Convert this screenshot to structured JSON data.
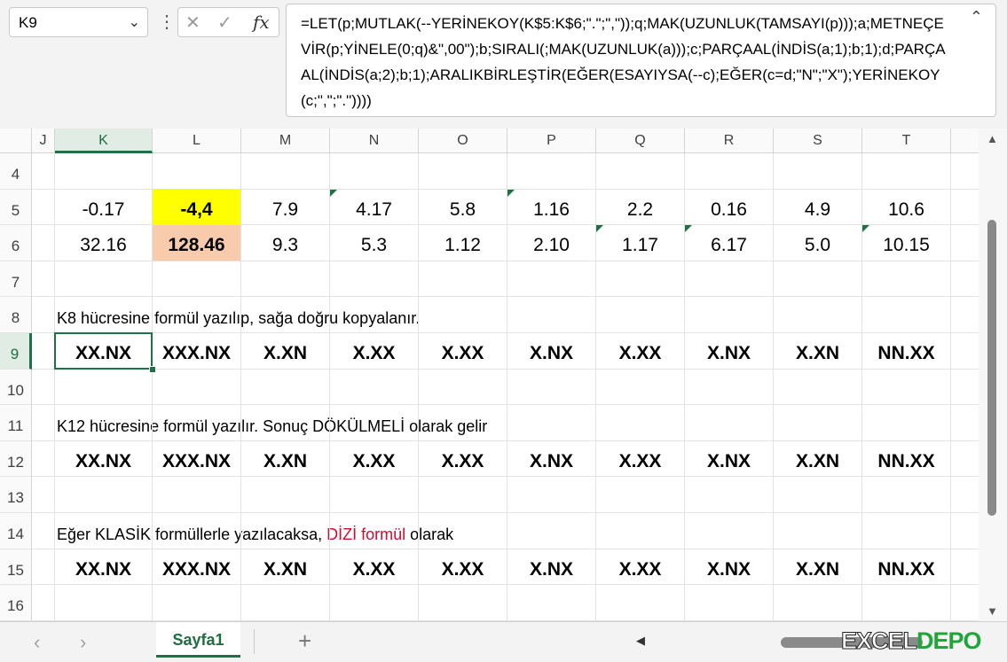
{
  "formula_bar": {
    "name_box": "K9",
    "cancel_icon": "✕",
    "enter_icon": "✓",
    "fx_label": "fx",
    "formula": "=LET(p;MUTLAK(--YERİNEKOY(K$5:K$6;\".\";\",\"));q;MAK(UZUNLUK(TAMSAYI(p)));a;METNEÇEVİR(p;YİNELE(0;q)&\",00\");b;SIRALI(;MAK(UZUNLUK(a)));c;PARÇAAL(İNDİS(a;1);b;1);d;PARÇAAL(İNDİS(a;2);b;1);ARALIKBİRLEŞTİR(EĞER(ESAYIYSA(--c);EĞER(c=d;\"N\";\"X\");YERİNEKOY(c;\",\";\".\"))))"
  },
  "columns": [
    "J",
    "K",
    "L",
    "M",
    "N",
    "O",
    "P",
    "Q",
    "R",
    "S",
    "T"
  ],
  "rows": [
    "4",
    "5",
    "6",
    "7",
    "8",
    "9",
    "10",
    "11",
    "12",
    "13",
    "14",
    "15",
    "16"
  ],
  "row5": [
    "-0.17",
    "-4,4",
    "7.9",
    "4.17",
    "5.8",
    "1.16",
    "2.2",
    "0.16",
    "4.9",
    "10.6"
  ],
  "row6": [
    "32.16",
    "128.46",
    "9.3",
    "5.3",
    "1.12",
    "2.10",
    "1.17",
    "6.17",
    "5.0",
    "10.15"
  ],
  "notes": {
    "row8": "K8 hücresine formül yazılıp, sağa doğru kopyalanır.",
    "row11": "K12 hücresine formül yazılır. Sonuç DÖKÜLMELİ olarak gelir",
    "row14_a": "Eğer KLASİK formüllerle yazılacaksa, ",
    "row14_b": "DİZİ formül",
    "row14_c": " olarak"
  },
  "results": {
    "row9": [
      "XX.NX",
      "XXX.NX",
      "X.XN",
      "X.XX",
      "X.XX",
      "X.NX",
      "X.XX",
      "X.NX",
      "X.XN",
      "NN.XX"
    ],
    "row12": [
      "XX.NX",
      "XXX.NX",
      "X.XN",
      "X.XX",
      "X.XX",
      "X.NX",
      "X.XX",
      "X.NX",
      "X.XN",
      "NN.XX"
    ],
    "row15": [
      "XX.NX",
      "XXX.NX",
      "X.XN",
      "X.XX",
      "X.XX",
      "X.NX",
      "X.XX",
      "X.NX",
      "X.XN",
      "NN.XX"
    ]
  },
  "sheet_tab": "Sayfa1",
  "nav_prev": "‹",
  "nav_next": "›",
  "add_sheet": "+",
  "scroll_up": "▲",
  "scroll_down": "▼",
  "scroll_left": "◀",
  "logo": {
    "part1": "EXCEL",
    "part2": "DEPO"
  },
  "colors": {
    "accent": "#1e7145",
    "highlight_yellow": "#ffff00",
    "highlight_peach": "#f8cbad",
    "red_text": "#d10a2f"
  }
}
